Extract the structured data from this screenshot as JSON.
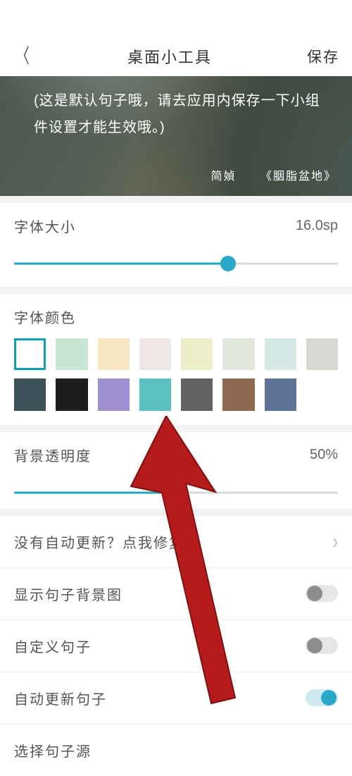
{
  "header": {
    "title": "桌面小工具",
    "save": "保存"
  },
  "preview": {
    "sentence": "(这是默认句子哦，请去应用内保存一下小组件设置才能生效哦。)",
    "author": "简媜",
    "book": "《胭脂盆地》"
  },
  "fontSize": {
    "label": "字体大小",
    "value": "16.0sp",
    "percent": 66
  },
  "fontColor": {
    "label": "字体颜色",
    "swatches": [
      "#ffffff",
      "#c6e5d2",
      "#f6e7c1",
      "#efe6e5",
      "#edefc8",
      "#e3e8de",
      "#d4e9e5",
      "#d5d9d2",
      "#3d5158",
      "#1d1d1d",
      "#9f8fd0",
      "#5bc0c0",
      "#636363",
      "#8e6a50",
      "#5c7397"
    ],
    "selected": 0
  },
  "bgOpacity": {
    "label": "背景透明度",
    "value": "50%",
    "percent": 50
  },
  "rows": {
    "autoFix": "没有自动更新？点我修复",
    "showBg": "显示句子背景图",
    "custom": "自定义句子",
    "autoUpd": "自动更新句子",
    "source": "选择句子源"
  },
  "toggles": {
    "showBg": false,
    "custom": false,
    "autoUpd": true
  }
}
